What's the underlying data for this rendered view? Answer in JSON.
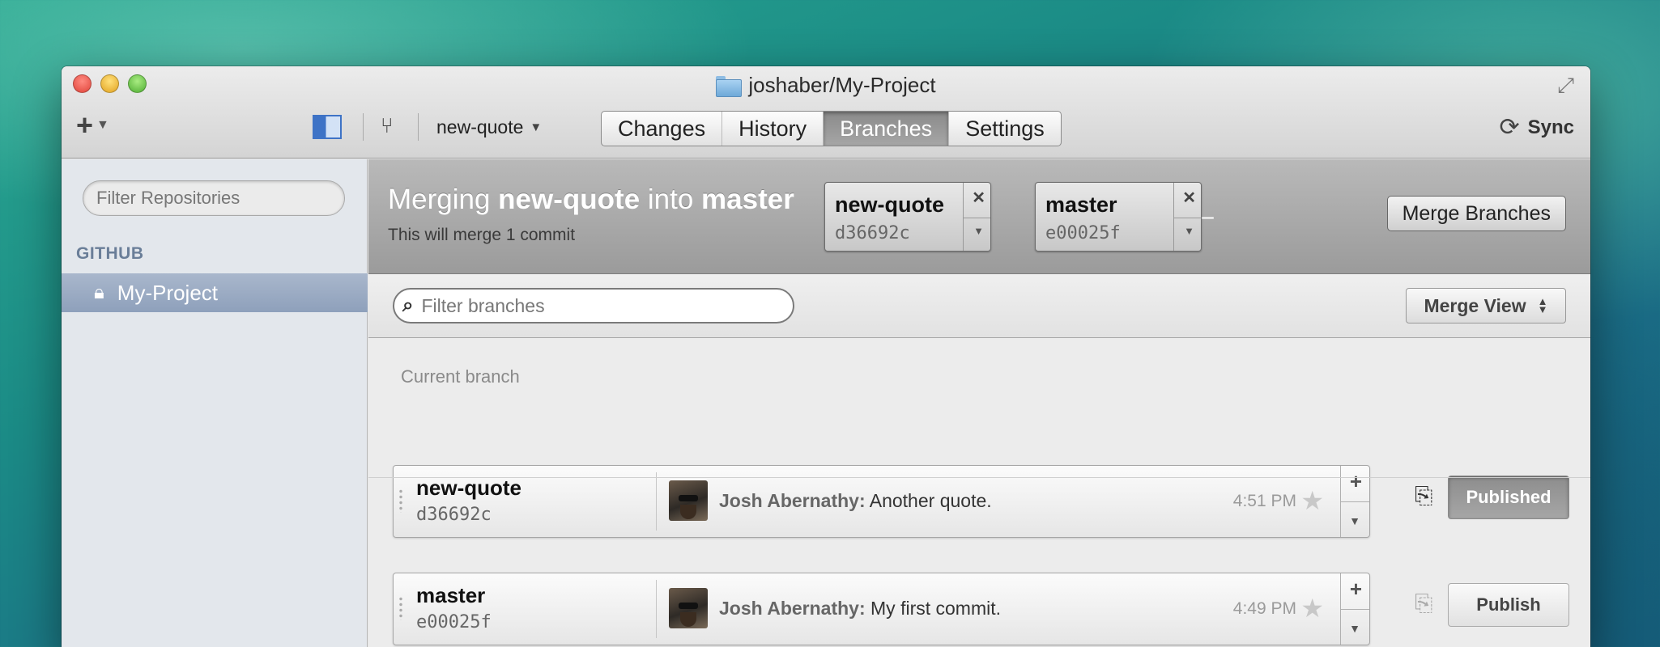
{
  "window": {
    "title": "joshaber/My-Project"
  },
  "toolbar": {
    "add_icon": "+",
    "current_branch": "new-quote",
    "tabs": [
      {
        "label": "Changes",
        "active": false
      },
      {
        "label": "History",
        "active": false
      },
      {
        "label": "Branches",
        "active": true
      },
      {
        "label": "Settings",
        "active": false
      }
    ],
    "sync_label": "Sync"
  },
  "sidebar": {
    "filter_placeholder": "Filter Repositories",
    "section_title": "GITHUB",
    "repos": [
      {
        "label": "My-Project",
        "selected": true
      }
    ]
  },
  "merge": {
    "prefix": "Merging ",
    "source": "new-quote",
    "middle": " into ",
    "target": "master",
    "subtitle": "This will merge 1 commit",
    "source_box": {
      "name": "new-quote",
      "sha": "d36692c"
    },
    "target_box": {
      "name": "master",
      "sha": "e00025f"
    },
    "button_label": "Merge Branches"
  },
  "branches_view": {
    "filter_placeholder": "Filter branches",
    "view_label": "Merge View",
    "current_section": "Current branch",
    "rows": [
      {
        "name": "new-quote",
        "sha": "d36692c",
        "author": "Josh Abernathy:",
        "message": " Another quote.",
        "time": "4:51 PM",
        "publish_label": "Published",
        "published": true
      },
      {
        "name": "master",
        "sha": "e00025f",
        "author": "Josh Abernathy:",
        "message": " My first commit.",
        "time": "4:49 PM",
        "publish_label": "Publish",
        "published": false
      }
    ]
  },
  "colors": {
    "sidebar_selection": "#9aabc4",
    "merge_bar": "#a9a9a9",
    "active_tab": "#979797",
    "accent_blue": "#3e73c6"
  }
}
